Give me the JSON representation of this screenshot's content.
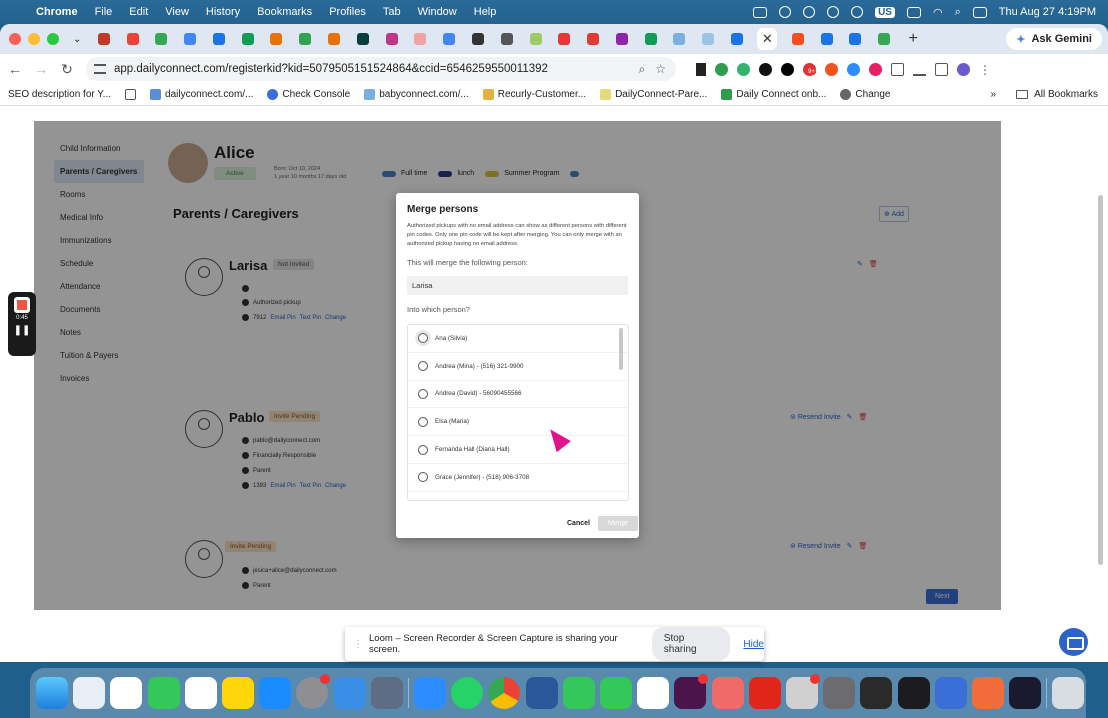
{
  "menubar": {
    "app": "Chrome",
    "items": [
      "File",
      "Edit",
      "View",
      "History",
      "Bookmarks",
      "Profiles",
      "Tab",
      "Window",
      "Help"
    ],
    "input_source": "US",
    "datetime": "Thu Aug 27  4:19PM"
  },
  "browser": {
    "url": "app.dailyconnect.com/registerkid?kid=5079505151524864&ccid=6546259550011392",
    "ask_gemini": "Ask Gemini",
    "extension_badge": "9+",
    "bookmarks": [
      {
        "label": "SEO description for Y...",
        "color": "#aaa"
      },
      {
        "label": "dailyconnect.com/...",
        "color": "#5a8fd6"
      },
      {
        "label": "Check Console",
        "color": "#3b6ed8"
      },
      {
        "label": "babyconnect.com/...",
        "color": "#7ab0e0"
      },
      {
        "label": "Recurly-Customer...",
        "color": "#e2b341"
      },
      {
        "label": "DailyConnect-Pare...",
        "color": "#e6d97a"
      },
      {
        "label": "Daily Connect onb...",
        "color": "#2e9e4d"
      },
      {
        "label": "Change",
        "color": "#666"
      }
    ],
    "all_bookmarks": "All Bookmarks"
  },
  "sidenav": [
    {
      "label": "Child Information",
      "active": false
    },
    {
      "label": "Parents / Caregivers",
      "active": true
    },
    {
      "label": "Rooms",
      "active": false
    },
    {
      "label": "Medical Info",
      "active": false
    },
    {
      "label": "Immunizations",
      "active": false
    },
    {
      "label": "Schedule",
      "active": false
    },
    {
      "label": "Attendance",
      "active": false
    },
    {
      "label": "Documents",
      "active": false
    },
    {
      "label": "Notes",
      "active": false
    },
    {
      "label": "Tuition & Payers",
      "active": false
    },
    {
      "label": "Invoices",
      "active": false
    }
  ],
  "child": {
    "name": "Alice",
    "status": "Active",
    "born": "Born: Oct 10, 2024",
    "age": "1 year 10 months 17 days old",
    "tags": [
      {
        "label": "Full time",
        "color": "#4a86c8"
      },
      {
        "label": "lunch",
        "color": "#2b3a8c"
      },
      {
        "label": "Summer Program",
        "color": "#d8c23a"
      },
      {
        "label": "",
        "color": "#4a86c8"
      }
    ]
  },
  "section_title": "Parents / Caregivers",
  "add_label": "Add",
  "persons": {
    "larisa": {
      "name": "Larisa",
      "badge": "Not Invited",
      "role": "Authorized pickup",
      "pin": "7912",
      "email_pin": "Email Pin",
      "text_pin": "Text Pin",
      "change": "Change"
    },
    "pablo": {
      "name": "Pablo",
      "badge": "Invite Pending",
      "email": "pablo@dailyconnect.com",
      "financial": "Financially Responsible",
      "role": "Parent",
      "pin": "1393",
      "email_pin": "Email Pin",
      "text_pin": "Text Pin",
      "change": "Change",
      "resend": "Resend Invite"
    },
    "third": {
      "badge": "Invite Pending",
      "email": "jesica+alice@dailyconnect.com",
      "role": "Parent",
      "resend": "Resend Invite"
    }
  },
  "next_label": "Next",
  "modal": {
    "title": "Merge persons",
    "description": "Authorized pickups with no email address can show as different persons with different pin codes. Only one pin code will be kept after merging. You can only merge with an authorized pickup having no email address.",
    "merge_label": "This will merge the following person:",
    "source_person": "Larisa",
    "into_label": "Into which person?",
    "options": [
      "Ana (Silvia)",
      "Andrea (Mina) - (516) 321-9900",
      "Andrea (David) - 56090455566",
      "Elsa (Maria)",
      "Fernanda Hall (Diana Hall)",
      "Grace (Jennifer) - (518) 906-3708"
    ],
    "cancel": "Cancel",
    "merge": "Merge"
  },
  "loom_timer": "0:45",
  "share_bar": {
    "message": "Loom – Screen Recorder & Screen Capture is sharing your screen.",
    "stop": "Stop sharing",
    "hide": "Hide"
  },
  "colors": {
    "accent": "#2b63c9",
    "delete": "#dd3333",
    "cursor": "#e0148a"
  }
}
